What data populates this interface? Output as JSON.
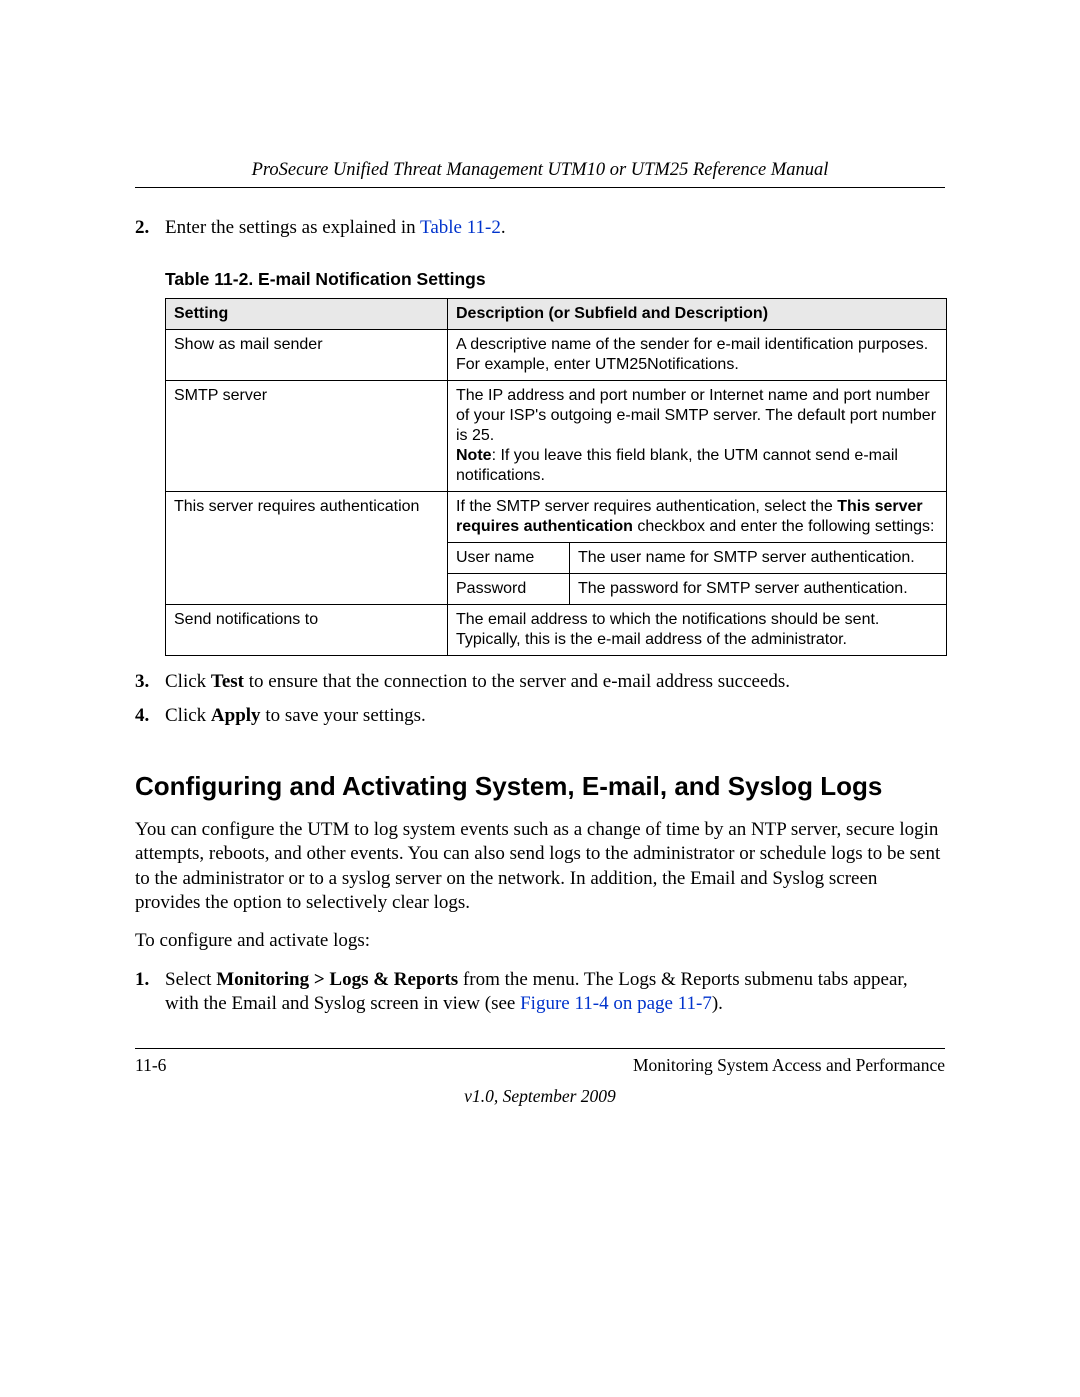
{
  "header": {
    "running_title": "ProSecure Unified Threat Management UTM10 or UTM25 Reference Manual"
  },
  "steps_a": {
    "s2": {
      "num": "2.",
      "pre": "Enter the settings as explained in ",
      "link": "Table 11-2",
      "post": "."
    }
  },
  "table": {
    "caption": "Table 11-2. E-mail Notification Settings",
    "head": {
      "c1": "Setting",
      "c2": "Description (or Subfield and Description)"
    },
    "r1": {
      "setting": "Show as mail sender",
      "desc": "A descriptive name of the sender for e-mail identification purposes. For example, enter UTM25Notifications."
    },
    "r2": {
      "setting": "SMTP server",
      "desc_pre": "The IP address and port number or Internet name and port number of your ISP's outgoing e-mail SMTP server. The default port number is 25.",
      "note_label": "Note",
      "note_text": ": If you leave this field blank, the UTM cannot send e-mail notifications."
    },
    "r3": {
      "setting": "This server requires authentication",
      "desc_pre": "If the SMTP server requires authentication, select the ",
      "bold": "This server requires authentication",
      "desc_post": " checkbox and enter the following settings:",
      "sub1_label": "User name",
      "sub1_desc": "The user name for SMTP server authentication.",
      "sub2_label": "Password",
      "sub2_desc": "The password for SMTP server authentication."
    },
    "r4": {
      "setting": "Send notifications to",
      "desc": "The email address to which the notifications should be sent. Typically, this is the e-mail address of the administrator."
    }
  },
  "steps_b": {
    "s3": {
      "num": "3.",
      "pre": "Click ",
      "bold": "Test",
      "post": " to ensure that the connection to the server and e-mail address succeeds."
    },
    "s4": {
      "num": "4.",
      "pre": "Click ",
      "bold": "Apply",
      "post": " to save your settings."
    }
  },
  "section": {
    "heading": "Configuring and Activating System, E-mail, and Syslog Logs",
    "p1": "You can configure the UTM to log system events such as a change of time by an NTP server, secure login attempts, reboots, and other events. You can also send logs to the administrator or schedule logs to be sent to the administrator or to a syslog server on the network. In addition, the Email and Syslog screen provides the option to selectively clear logs.",
    "p2": "To configure and activate logs:",
    "step1": {
      "num": "1.",
      "pre": "Select ",
      "bold": "Monitoring > Logs & Reports",
      "mid": " from the menu. The Logs & Reports submenu tabs appear, with the Email and Syslog screen in view (see ",
      "link": "Figure 11-4 on page 11-7",
      "post": ")."
    }
  },
  "footer": {
    "page_num": "11-6",
    "chapter": "Monitoring System Access and Performance",
    "version": "v1.0, September 2009"
  }
}
